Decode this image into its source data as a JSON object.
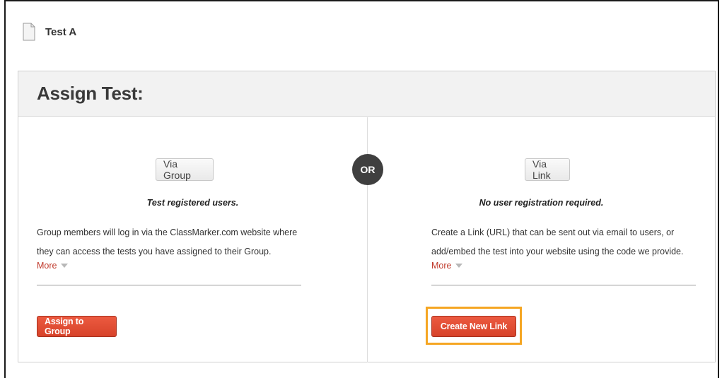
{
  "test": {
    "title": "Test A",
    "icon": "document-icon"
  },
  "panel": {
    "title": "Assign Test:",
    "or_label": "OR"
  },
  "group": {
    "method_label": "Via Group",
    "subtitle": "Test registered users.",
    "desc_line1": "Group members will log in via the ClassMarker.com website where",
    "desc_line2": "they can access the tests you have assigned to their Group.",
    "more_label": "More",
    "action_label": "Assign to Group"
  },
  "link": {
    "method_label": "Via Link",
    "subtitle": "No user registration required.",
    "desc_line1": "Create a Link (URL) that can be sent out via email to users, or",
    "desc_line2": "add/embed the test into your website using the code we provide.",
    "more_label": "More",
    "action_label": "Create New Link"
  },
  "colors": {
    "action_button": "#e04e33",
    "highlight_outline": "#f5a623",
    "or_badge": "#3f3f3f",
    "more_link": "#c0392b"
  }
}
